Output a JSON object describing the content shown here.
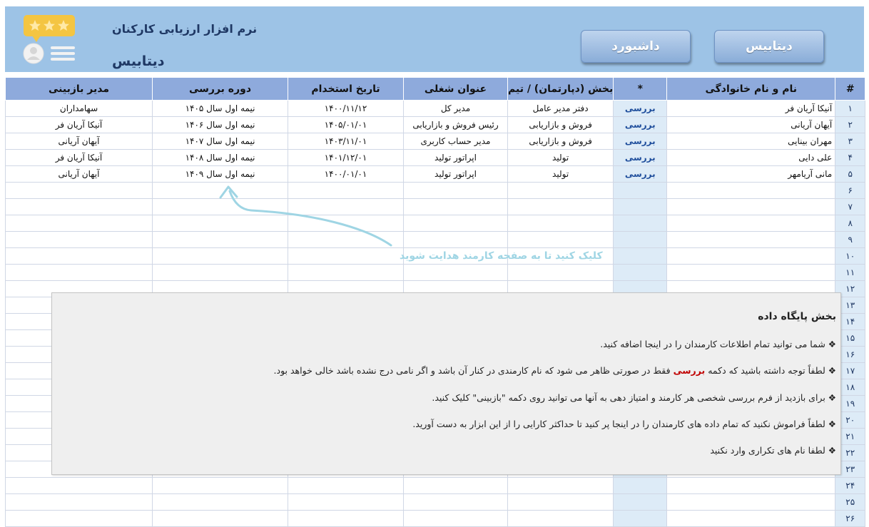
{
  "header": {
    "app_title": "نرم افزار ارزیابی کارکنان",
    "page_title": "دیتابیس",
    "buttons": {
      "database": "دیتابیس",
      "dashboard": "داشبورد"
    },
    "logo_icon": "rating-card-icon",
    "colors": {
      "header_bg": "#9dc3e6",
      "title": "#1f3864",
      "star": "#f4c542",
      "bubble": "#f4c542"
    }
  },
  "table": {
    "headers": {
      "num": "#",
      "name": "نام و نام خانوادگی",
      "review": "*",
      "department": "بخش (دپارتمان) / تیم",
      "job": "عنوان شغلی",
      "hire_date": "تاریخ استخدام",
      "period": "دوره بررسی",
      "manager": "مدیر بازبینی"
    },
    "review_label": "بررسی",
    "rows": [
      {
        "num": "۱",
        "name": "آنیکا آریان فر",
        "review": "بررسی",
        "department": "دفتر مدیر عامل",
        "job": "مدیر کل",
        "hire_date": "۱۴۰۰/۱۱/۱۲",
        "period": "نیمه اول سال ۱۴۰۵",
        "manager": "سهامداران"
      },
      {
        "num": "۲",
        "name": "آیهان آریانی",
        "review": "بررسی",
        "department": "فروش و بازاریابی",
        "job": "رئیس فروش و بازاریابی",
        "hire_date": "۱۴۰۵/۰۱/۰۱",
        "period": "نیمه اول سال ۱۴۰۶",
        "manager": "آنیکا آریان فر"
      },
      {
        "num": "۳",
        "name": "مهران بینایی",
        "review": "بررسی",
        "department": "فروش و بازاریابی",
        "job": "مدیر حساب کاربری",
        "hire_date": "۱۴۰۳/۱۱/۰۱",
        "period": "نیمه اول سال ۱۴۰۷",
        "manager": "آیهان آریانی"
      },
      {
        "num": "۴",
        "name": "علی دایی",
        "review": "بررسی",
        "department": "تولید",
        "job": "اپراتور تولید",
        "hire_date": "۱۴۰۱/۱۲/۰۱",
        "period": "نیمه اول سال ۱۴۰۸",
        "manager": "آنیکا آریان فر"
      },
      {
        "num": "۵",
        "name": "مانی آریامهر",
        "review": "بررسی",
        "department": "تولید",
        "job": "اپراتور تولید",
        "hire_date": "۱۴۰۰/۰۱/۰۱",
        "period": "نیمه اول سال ۱۴۰۹",
        "manager": "آیهان آریانی"
      }
    ],
    "empty_row_numbers": [
      "۶",
      "۷",
      "۸",
      "۹",
      "۱۰",
      "۱۱",
      "۱۲",
      "۱۳",
      "۱۴",
      "۱۵",
      "۱۶",
      "۱۷",
      "۱۸",
      "۱۹",
      "۲۰",
      "۲۱",
      "۲۲",
      "۲۳",
      "۲۴",
      "۲۵",
      "۲۶"
    ],
    "colors": {
      "header_bg": "#8eaadc",
      "review_col_bg": "#ddebf7",
      "review_text": "#1f4e9c"
    }
  },
  "hint": {
    "text": "کلیک کنید تا به صفحه کارمند هدایت شوید",
    "color": "#9fd5e4",
    "arrow_icon": "curved-arrow-icon"
  },
  "info_box": {
    "title": "بخش پایگاه داده",
    "bullet": "❖",
    "lines": [
      {
        "text": "شما می توانید تمام اطلاعات کارمندان را در اینجا اضافه کنید."
      },
      {
        "pre": "لطفاً توجه داشته باشید که دکمه",
        "bold": "بررسی",
        "post": "فقط در صورتی ظاهر می شود که نام کارمندی در کنار آن باشد و اگر نامی درج نشده باشد خالی خواهد بود."
      },
      {
        "text": "برای بازدید از فرم بررسی شخصی هر کارمند و امتیاز دهی به آنها می توانید روی دکمه \"بازبینی\" کلیک کنید."
      },
      {
        "text": "لطفاً فراموش نکنید که تمام داده های کارمندان را در اینجا پر کنید تا حداکثر کارایی را از این ابزار به دست آورید."
      },
      {
        "text": "لطفا نام های تکراری وارد نکنید"
      }
    ]
  }
}
